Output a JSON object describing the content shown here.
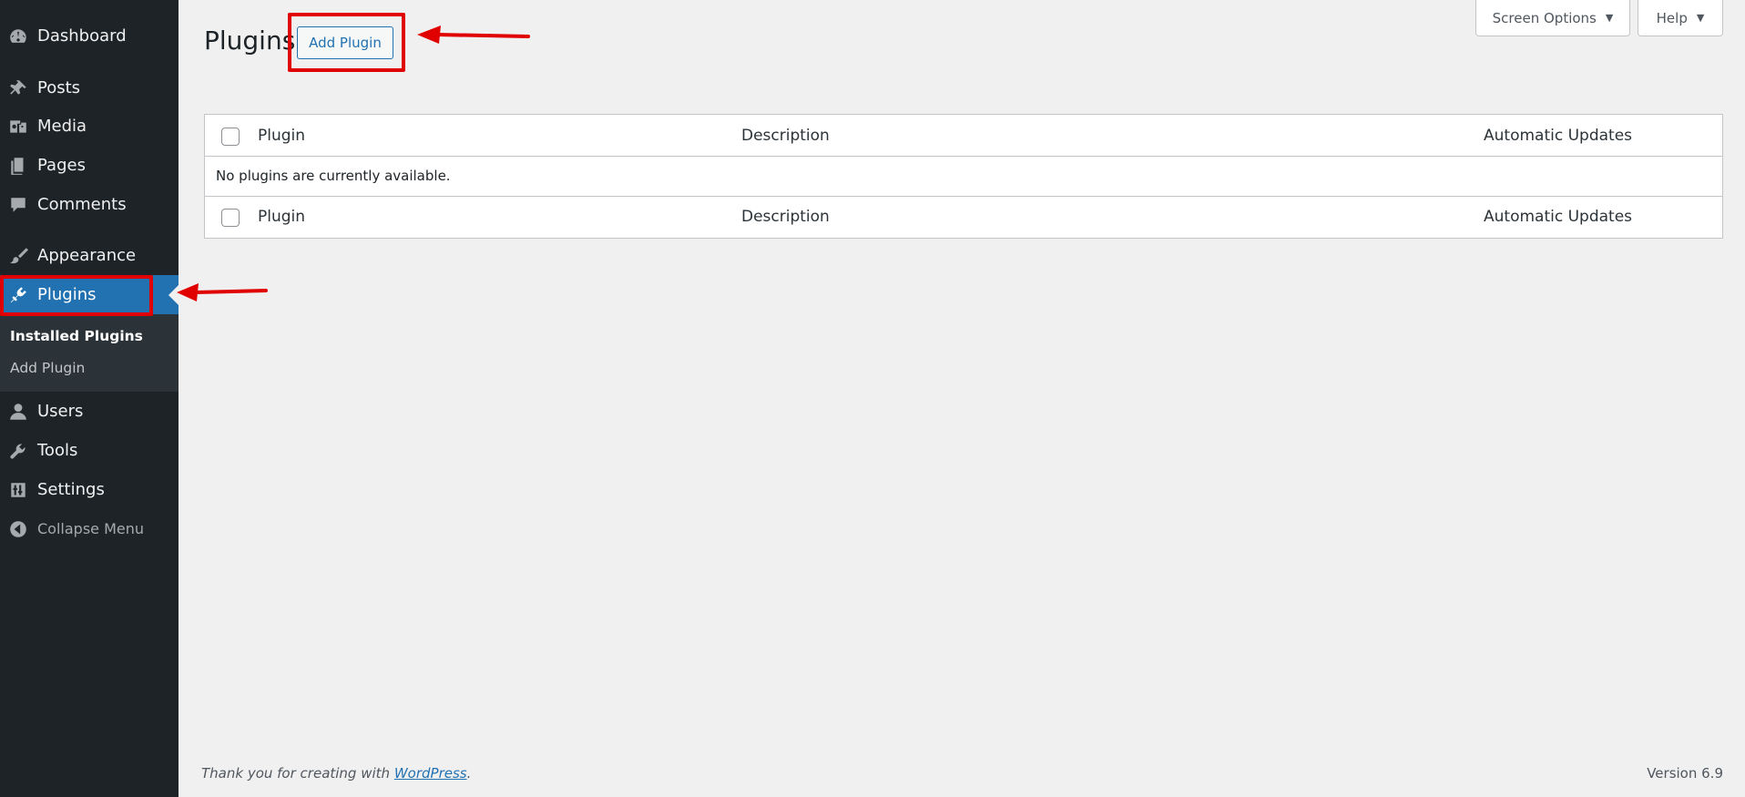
{
  "sidebar": {
    "items": [
      {
        "label": "Dashboard",
        "icon": "dashboard-icon"
      },
      {
        "label": "Posts",
        "icon": "pin-icon"
      },
      {
        "label": "Media",
        "icon": "media-icon"
      },
      {
        "label": "Pages",
        "icon": "pages-icon"
      },
      {
        "label": "Comments",
        "icon": "comment-icon"
      },
      {
        "label": "Appearance",
        "icon": "brush-icon"
      },
      {
        "label": "Plugins",
        "icon": "plugin-icon",
        "current": true
      },
      {
        "label": "Users",
        "icon": "user-icon"
      },
      {
        "label": "Tools",
        "icon": "wrench-icon"
      },
      {
        "label": "Settings",
        "icon": "settings-icon"
      },
      {
        "label": "Collapse Menu",
        "icon": "collapse-icon"
      }
    ],
    "submenu": [
      {
        "label": "Installed Plugins",
        "active": true
      },
      {
        "label": "Add Plugin"
      }
    ]
  },
  "header": {
    "title": "Plugins",
    "add_button": "Add Plugin",
    "screen_options": "Screen Options",
    "help": "Help",
    "caret": "▼"
  },
  "table": {
    "columns": [
      "Plugin",
      "Description",
      "Automatic Updates"
    ],
    "empty_message": "No plugins are currently available."
  },
  "footer": {
    "thanks_prefix": "Thank you for creating with ",
    "thanks_link": "WordPress",
    "thanks_suffix": ".",
    "version": "Version 6.9"
  },
  "colors": {
    "sidebar_bg": "#1d2327",
    "accent": "#2271b1",
    "highlight": "#e00000"
  }
}
